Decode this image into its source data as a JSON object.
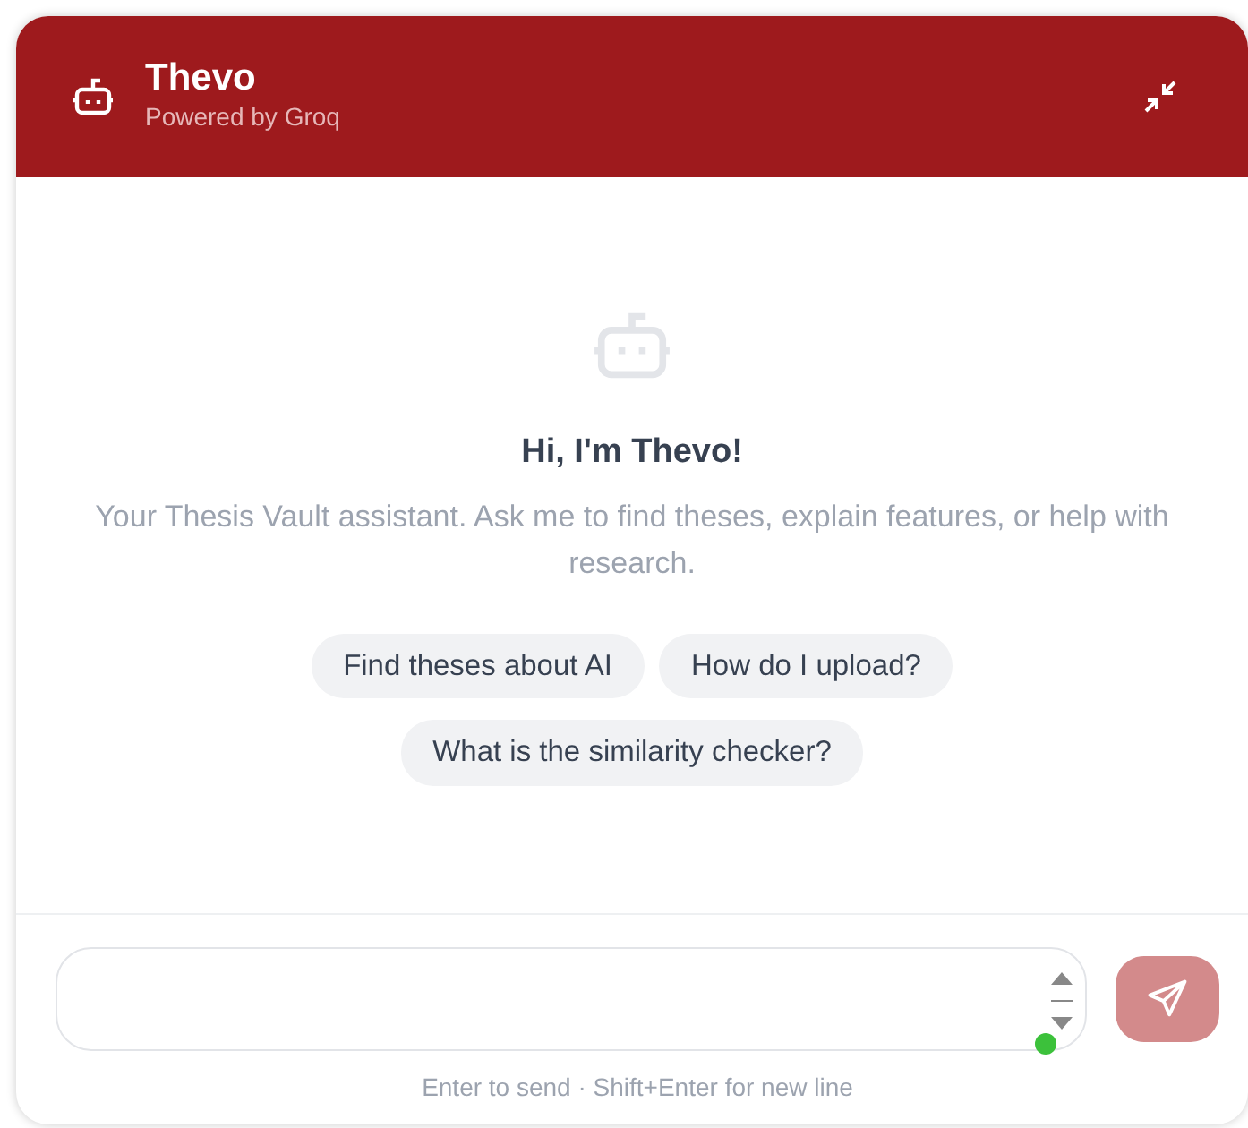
{
  "header": {
    "title": "Thevo",
    "subtitle": "Powered by Groq"
  },
  "welcome": {
    "title": "Hi, I'm Thevo!",
    "text": "Your Thesis Vault assistant. Ask me to find theses, explain features, or help with research."
  },
  "suggestions": [
    "Find theses about AI",
    "How do I upload?",
    "What is the similarity checker?"
  ],
  "composer": {
    "send_disabled": true,
    "hint": "Enter to send · Shift+Enter for new line"
  }
}
